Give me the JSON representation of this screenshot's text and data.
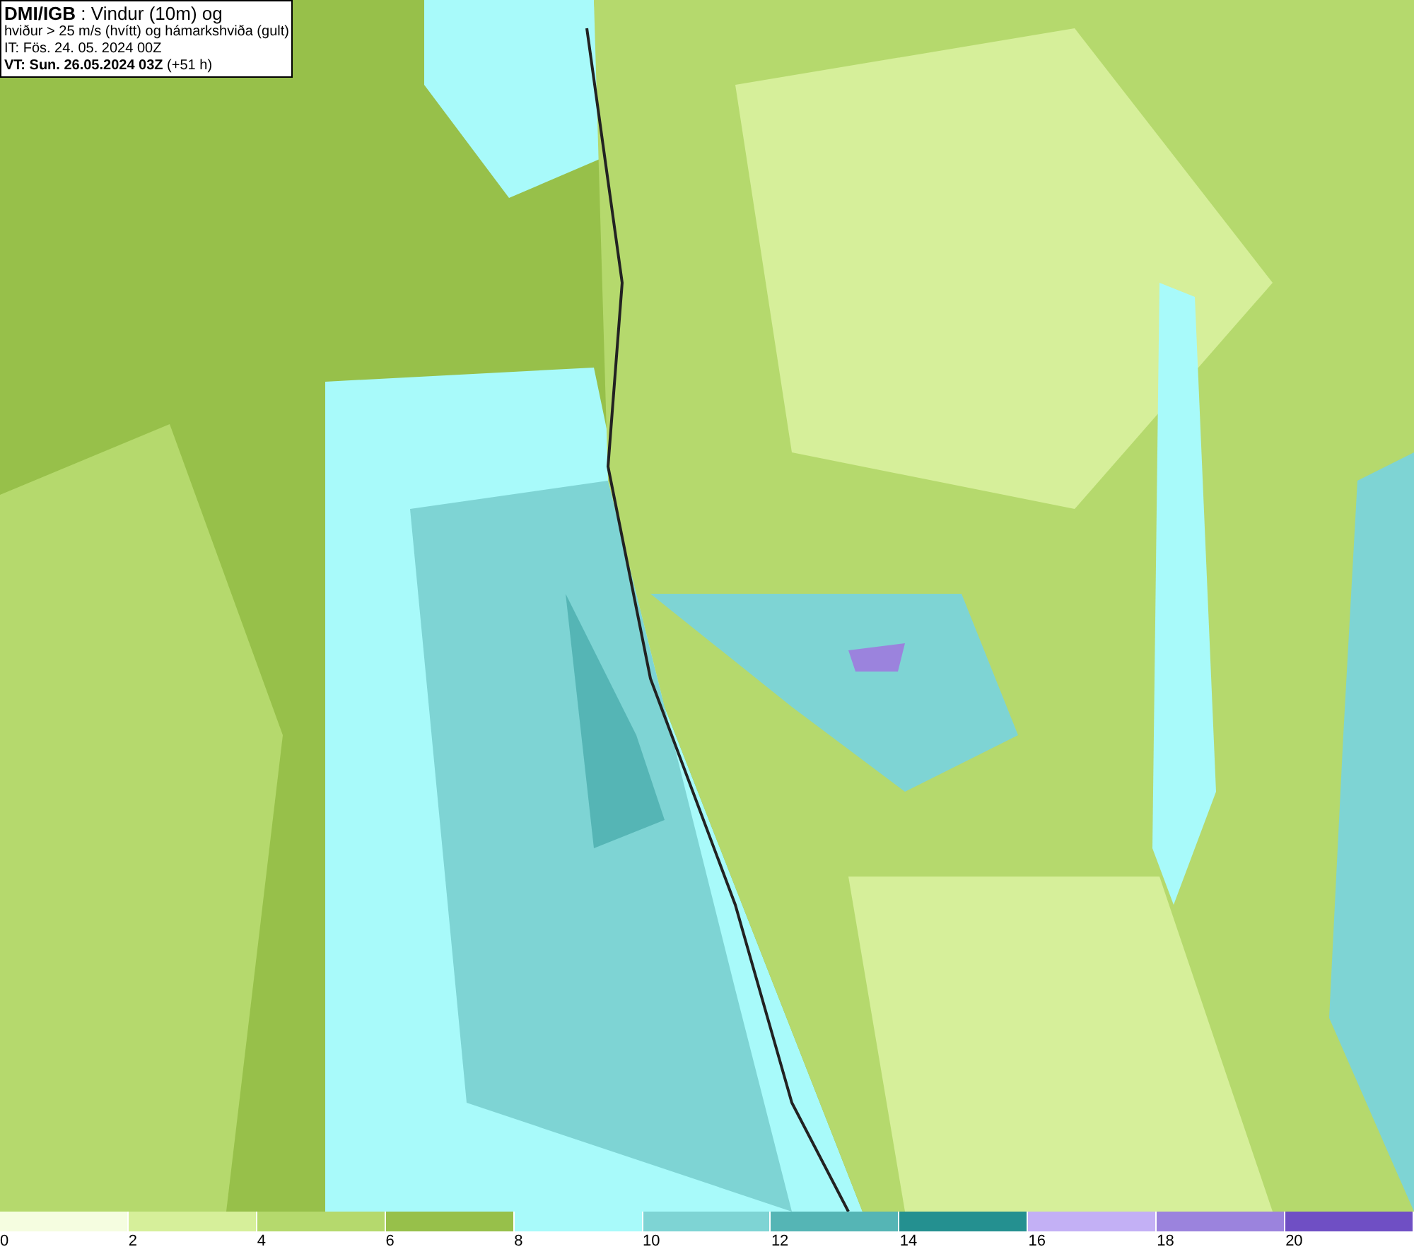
{
  "legend": {
    "lines": [
      "**DMI/IGB** : Vindur (10m) og",
      "hviður > 25 m/s (hvítt) og hámarkshviða (gult)",
      "IT: Fös. 24. 05. 2024 00Z",
      "**VT: Sun. 26.05.2024 03Z** (+51 h)"
    ]
  },
  "colorbar": [
    {
      "label": "0",
      "color": "#f5fde0"
    },
    {
      "label": "2",
      "color": "#d6ef9a"
    },
    {
      "label": "4",
      "color": "#b5d96d"
    },
    {
      "label": "6",
      "color": "#97c04a"
    },
    {
      "label": "8",
      "color": "#a8fafa"
    },
    {
      "label": "10",
      "color": "#7ed4d4"
    },
    {
      "label": "12",
      "color": "#55b5b5"
    },
    {
      "label": "14",
      "color": "#249090"
    },
    {
      "label": "16",
      "color": "#c3b0f5"
    },
    {
      "label": "18",
      "color": "#9b83dd"
    },
    {
      "label": "20",
      "color": "#6f4fc4"
    }
  ]
}
